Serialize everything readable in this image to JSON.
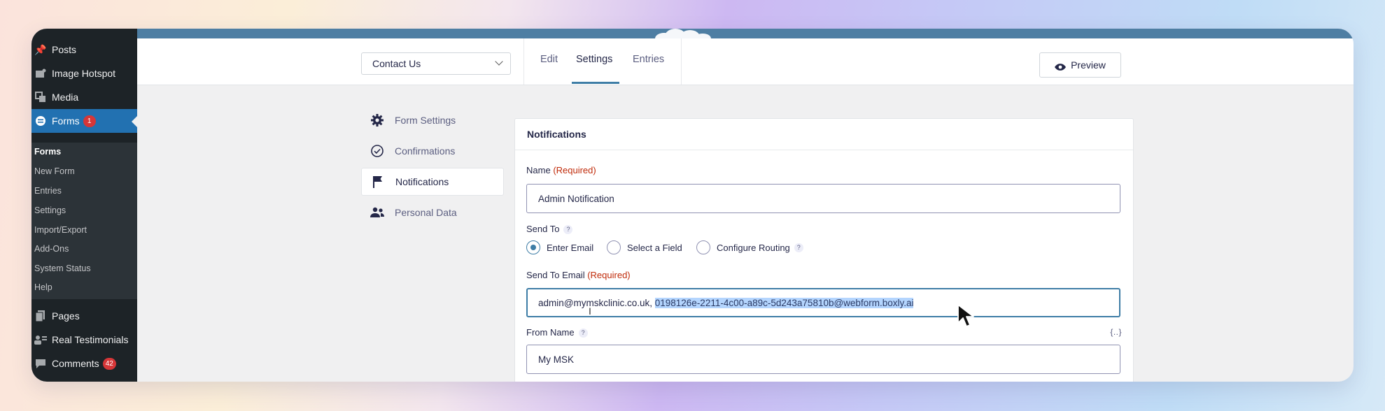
{
  "sidebar": {
    "items": [
      {
        "label": "Posts",
        "icon": "pin-icon"
      },
      {
        "label": "Image Hotspot",
        "icon": "image-hotspot-icon"
      },
      {
        "label": "Media",
        "icon": "media-icon"
      },
      {
        "label": "Forms",
        "icon": "forms-icon",
        "badge": "1"
      },
      {
        "label": "Pages",
        "icon": "pages-icon"
      },
      {
        "label": "Real Testimonials",
        "icon": "testimonials-icon"
      },
      {
        "label": "Comments",
        "icon": "comments-icon",
        "badge": "42"
      }
    ],
    "submenu": [
      "Forms",
      "New Form",
      "Entries",
      "Settings",
      "Import/Export",
      "Add-Ons",
      "System Status",
      "Help"
    ]
  },
  "toolbar": {
    "form_select": "Contact Us",
    "tabs": [
      "Edit",
      "Settings",
      "Entries"
    ],
    "active_tab": "Settings",
    "preview_label": "Preview"
  },
  "settings_nav": [
    {
      "label": "Form Settings",
      "icon": "gear-icon"
    },
    {
      "label": "Confirmations",
      "icon": "check-circle-icon"
    },
    {
      "label": "Notifications",
      "icon": "flag-icon"
    },
    {
      "label": "Personal Data",
      "icon": "people-icon"
    }
  ],
  "panel": {
    "title": "Notifications",
    "name_label": "Name",
    "required": "(Required)",
    "name_value": "Admin Notification",
    "send_to_label": "Send To",
    "help": "?",
    "radios": [
      "Enter Email",
      "Select a Field",
      "Configure Routing"
    ],
    "send_to_email_label": "Send To Email",
    "send_to_email_plain": "admin@mymskclinic.co.uk, ",
    "send_to_email_selected": "0198126e-2211-4c00-a89c-5d243a75810b@webform.boxly.ai",
    "from_name_label": "From Name",
    "merge_tag": "{..}",
    "from_name_value": "My MSK"
  },
  "colors": {
    "sidebar_bg": "#1d2327",
    "accent": "#2271b1",
    "badge": "#d63638",
    "topbar": "#4e7ea3",
    "required": "#c02b0a",
    "selection": "#b4d5fe"
  }
}
